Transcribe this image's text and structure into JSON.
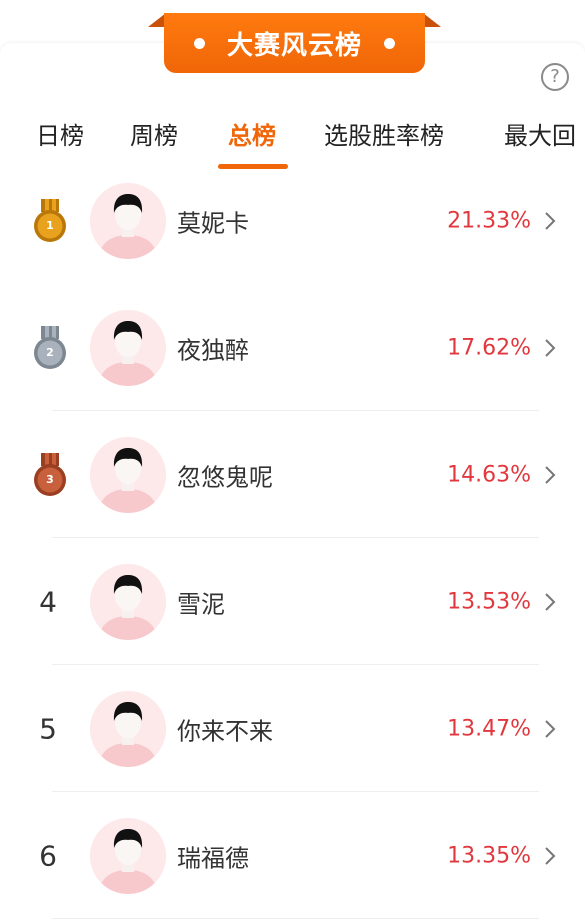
{
  "header": {
    "title": "大赛风云榜"
  },
  "tabs": [
    {
      "label": "日榜",
      "active": false
    },
    {
      "label": "周榜",
      "active": false
    },
    {
      "label": "总榜",
      "active": true
    },
    {
      "label": "选股胜率榜",
      "active": false
    },
    {
      "label": "最大回",
      "active": false
    }
  ],
  "help": {
    "icon": "question-icon",
    "symbol": "?"
  },
  "colors": {
    "accent": "#f06608",
    "percent": "#e0383e",
    "gold": "#e8a21d",
    "silver": "#a9b2bc",
    "bronze": "#c8603d"
  },
  "rankings": [
    {
      "rank": "1",
      "name": "莫妮卡",
      "value": "21.33%",
      "medal": "gold"
    },
    {
      "rank": "2",
      "name": "夜独醉",
      "value": "17.62%",
      "medal": "silver"
    },
    {
      "rank": "3",
      "name": "忽悠鬼呢",
      "value": "14.63%",
      "medal": "bronze"
    },
    {
      "rank": "4",
      "name": "雪泥",
      "value": "13.53%",
      "medal": null
    },
    {
      "rank": "5",
      "name": "你来不来",
      "value": "13.47%",
      "medal": null
    },
    {
      "rank": "6",
      "name": "瑞福德",
      "value": "13.35%",
      "medal": null
    }
  ]
}
